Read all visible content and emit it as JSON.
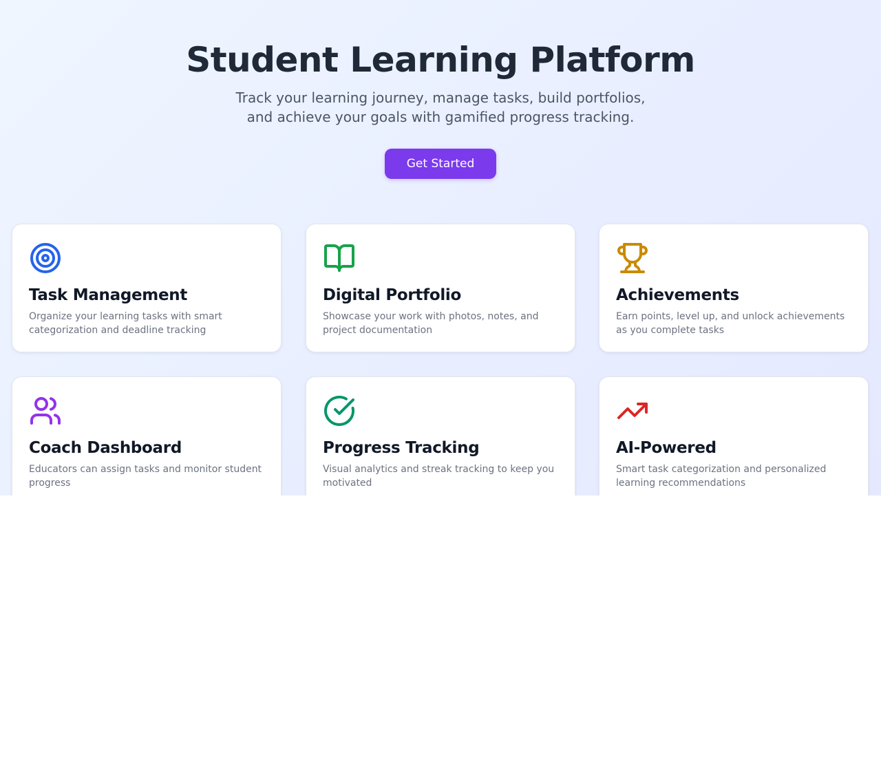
{
  "hero": {
    "title": "Student Learning Platform",
    "subtitle": "Track your learning journey, manage tasks, build portfolios, and achieve your goals with gamified progress tracking.",
    "cta_label": "Get Started",
    "cta_color": "#7c3aed"
  },
  "features": [
    {
      "title": "Task Management",
      "description": "Organize your learning tasks with smart categorization and deadline tracking",
      "icon": "target-icon",
      "icon_color": "#2563eb"
    },
    {
      "title": "Digital Portfolio",
      "description": "Showcase your work with photos, notes, and project documentation",
      "icon": "book-open-icon",
      "icon_color": "#16a34a"
    },
    {
      "title": "Achievements",
      "description": "Earn points, level up, and unlock achievements as you complete tasks",
      "icon": "trophy-icon",
      "icon_color": "#ca8a04"
    },
    {
      "title": "Coach Dashboard",
      "description": "Educators can assign tasks and monitor student progress",
      "icon": "users-icon",
      "icon_color": "#9333ea"
    },
    {
      "title": "Progress Tracking",
      "description": "Visual analytics and streak tracking to keep you motivated",
      "icon": "check-circle-icon",
      "icon_color": "#059669"
    },
    {
      "title": "AI-Powered",
      "description": "Smart task categorization and personalized learning recommendations",
      "icon": "trending-up-icon",
      "icon_color": "#dc2626"
    }
  ]
}
